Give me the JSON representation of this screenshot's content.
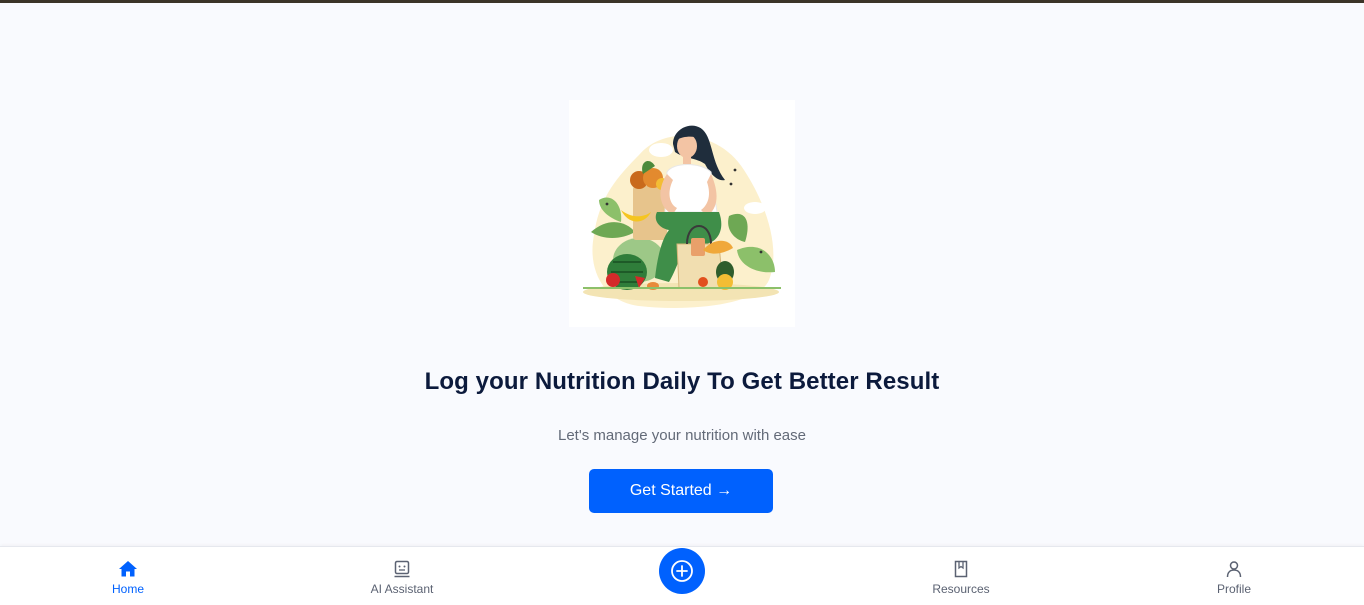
{
  "hero": {
    "title": "Log your Nutrition Daily To Get Better Result",
    "subtitle": "Let's manage your nutrition with ease",
    "cta_label": "Get Started →",
    "illustration": "woman-with-vegetables-illustration"
  },
  "bottom_nav": {
    "items": [
      {
        "label": "Home",
        "icon": "home-icon",
        "active": true
      },
      {
        "label": "AI Assistant",
        "icon": "assistant-icon",
        "active": false
      },
      {
        "label": "Resources",
        "icon": "book-icon",
        "active": false
      },
      {
        "label": "Profile",
        "icon": "user-icon",
        "active": false
      }
    ],
    "fab_icon": "plus-circle-icon"
  },
  "colors": {
    "accent": "#0061fe",
    "title": "#0c1a3c",
    "subtitle": "#636a78",
    "background": "#f9fafe"
  }
}
